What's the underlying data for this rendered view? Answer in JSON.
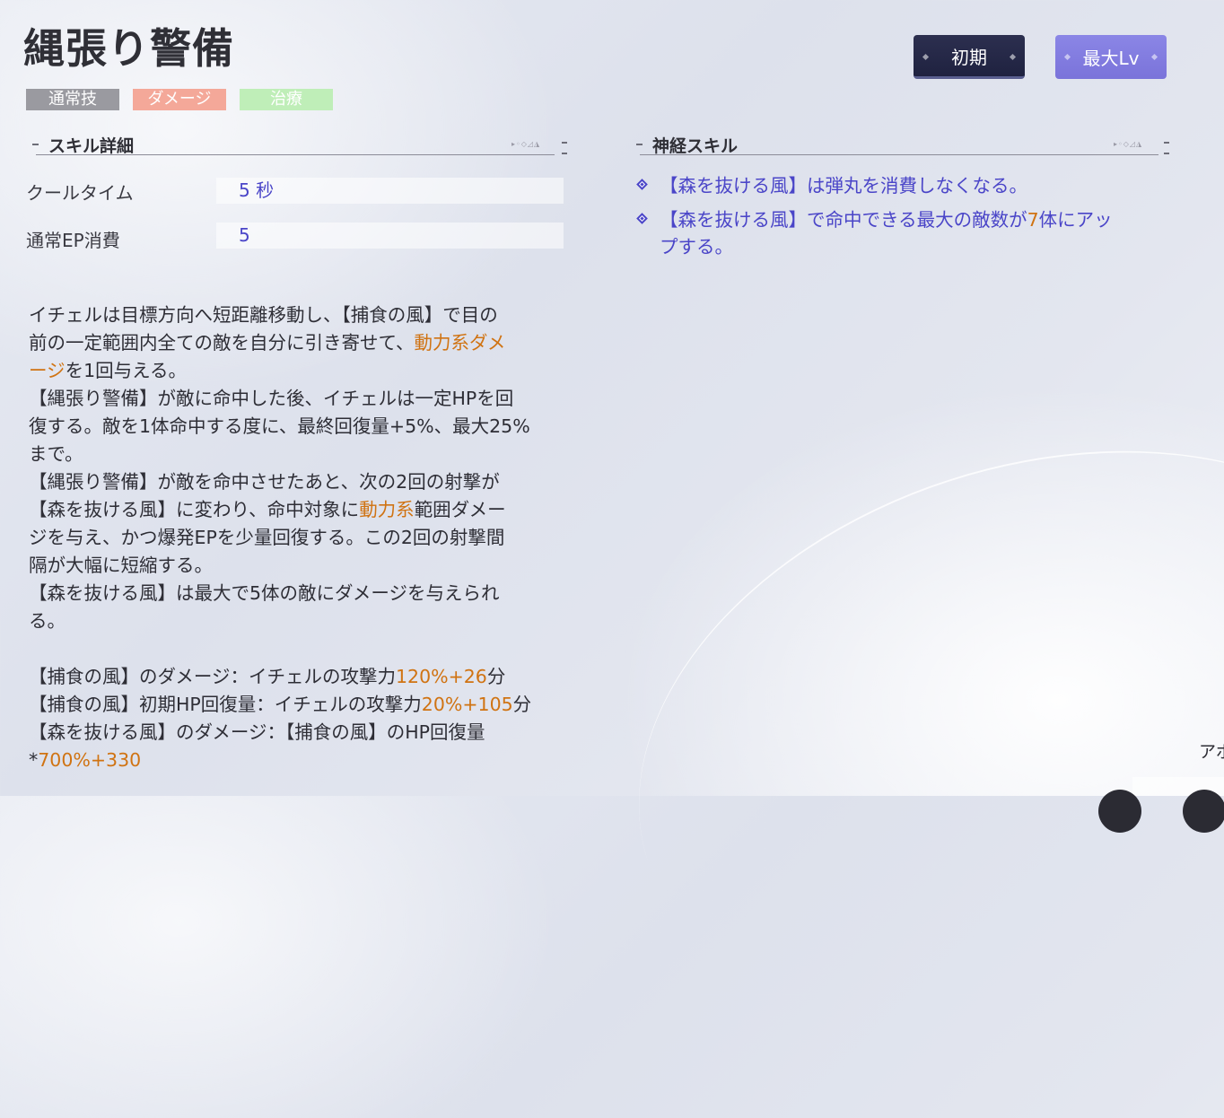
{
  "skill": {
    "title": "縄張り警備",
    "tags": [
      {
        "label": "通常技",
        "color": "#9a9aa0"
      },
      {
        "label": "ダメージ",
        "color": "#f4a899"
      },
      {
        "label": "治療",
        "color": "#bfeeb8"
      }
    ]
  },
  "level_buttons": {
    "initial": "初期",
    "max": "最大Lv"
  },
  "details": {
    "header": "スキル詳細",
    "cooldown_label": "クールタイム",
    "cooldown_value": "5 秒",
    "ep_label": "通常EP消費",
    "ep_value": "5"
  },
  "description": {
    "lines": [
      [
        "イチェルは目標方向へ短距離移動し、【捕食の風】で目の"
      ],
      [
        "前の一定範囲内全ての敵を自分に引き寄せて、",
        {
          "hl": "動力系ダメ"
        }
      ],
      [
        {
          "hl": "ージ"
        },
        "を1回与える。"
      ],
      [
        "【縄張り警備】が敵に命中した後、イチェルは一定HPを回"
      ],
      [
        "復する。敵を1体命中する度に、最終回復量+5%、最大25%"
      ],
      [
        "まで。"
      ],
      [
        "【縄張り警備】が敵を命中させたあと、次の2回の射撃が"
      ],
      [
        "【森を抜ける風】に変わり、命中対象に",
        {
          "hl": "動力系"
        },
        "範囲ダメー"
      ],
      [
        "ジを与え、かつ爆発EPを少量回復する。この2回の射撃間"
      ],
      [
        "隔が大幅に短縮する。"
      ],
      [
        "【森を抜ける風】は最大で5体の敵にダメージを与えられ"
      ],
      [
        "る。"
      ],
      [],
      [
        "【捕食の風】のダメージ：イチェルの攻撃力",
        {
          "hl": "120%+26"
        },
        "分"
      ],
      [
        "【捕食の風】初期HP回復量：イチェルの攻撃力",
        {
          "hl": "20%+105"
        },
        "分"
      ],
      [
        "【森を抜ける風】のダメージ：【捕食の風】のHP回復量"
      ],
      [
        "*",
        {
          "hl": "700%+330"
        }
      ]
    ]
  },
  "neural": {
    "header": "神経スキル",
    "items": [
      {
        "lines": [
          [
            "【森を抜ける風】は弾丸を消費しなくなる。"
          ]
        ]
      },
      {
        "lines": [
          [
            "【森を抜ける風】で命中できる最大の敵数が",
            {
              "hl": "7"
            },
            "体にアッ"
          ],
          [
            "プする。"
          ]
        ]
      }
    ]
  },
  "corner": {
    "text": "アボ"
  },
  "colors": {
    "accent_value": "#4a45c8",
    "highlight": "#d07312",
    "initial_button": "#24274a",
    "max_button": "#8580e2"
  }
}
